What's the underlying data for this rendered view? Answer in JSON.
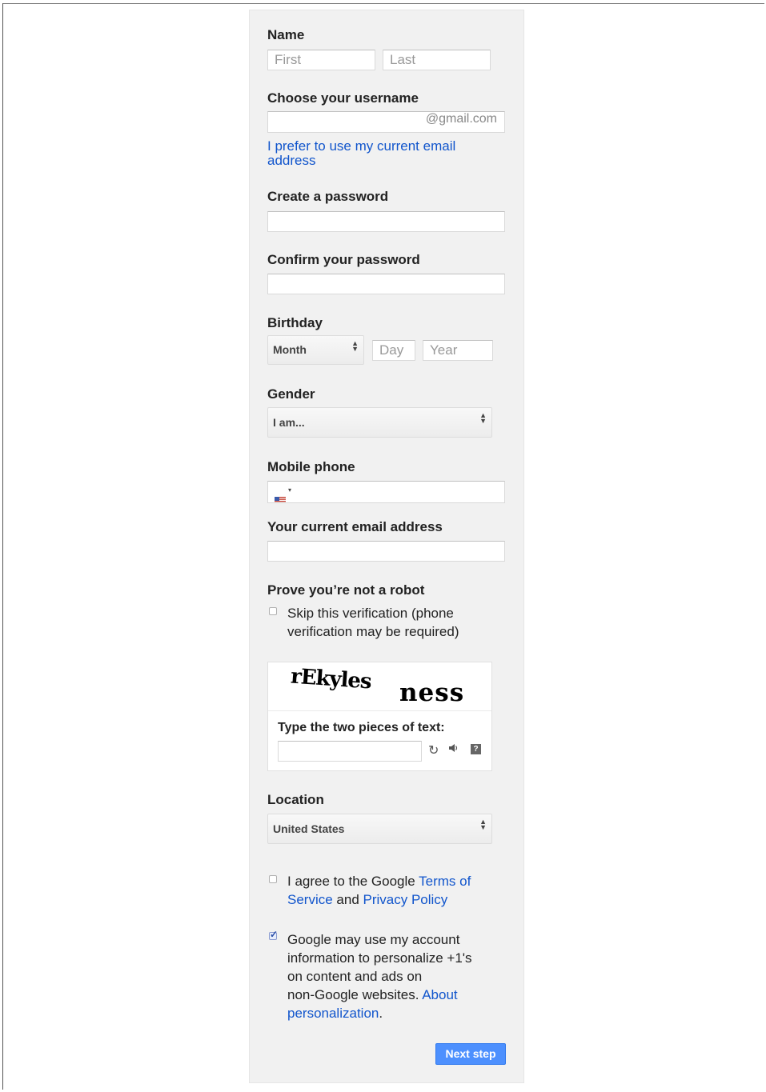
{
  "name": {
    "label": "Name",
    "first_placeholder": "First",
    "last_placeholder": "Last"
  },
  "username": {
    "label": "Choose your username",
    "suffix": "@gmail.com",
    "alt_link": "I prefer to use my current email address"
  },
  "password": {
    "label": "Create a password"
  },
  "confirm_password": {
    "label": "Confirm your password"
  },
  "birthday": {
    "label": "Birthday",
    "month_value": "Month",
    "day_placeholder": "Day",
    "year_placeholder": "Year"
  },
  "gender": {
    "label": "Gender",
    "value": "I am..."
  },
  "mobile": {
    "label": "Mobile phone",
    "flag_icon": "us-flag-icon"
  },
  "current_email": {
    "label": "Your current email address"
  },
  "robot": {
    "label": "Prove you’re not a robot",
    "skip_text_line1": "Skip this verification (phone",
    "skip_text_line2": "verification may be required)",
    "skip_checked": false
  },
  "captcha": {
    "word1": "rEkyles",
    "word2": "ness",
    "prompt": "Type the two pieces of text:",
    "refresh_icon": "refresh-icon",
    "audio_icon": "audio-icon",
    "help_icon": "help-icon"
  },
  "location": {
    "label": "Location",
    "value": "United States"
  },
  "terms": {
    "checked": false,
    "text1": "I agree to the Google ",
    "terms_link_line1": "Terms of",
    "terms_link_line2": "Service",
    "text2": " and ",
    "privacy_link": "Privacy Policy"
  },
  "personalize": {
    "checked": true,
    "line1": "Google may use my account",
    "line2": "information to personalize +1's",
    "line3": "on content and ads on",
    "line4": "non-Google websites. ",
    "about_link_line1": "About",
    "about_link_line2": "personalization",
    "period": "."
  },
  "next_button": "Next step",
  "colors": {
    "link": "#1155cc",
    "primary_button": "#4d90fe",
    "panel_bg": "#f1f1f1"
  }
}
